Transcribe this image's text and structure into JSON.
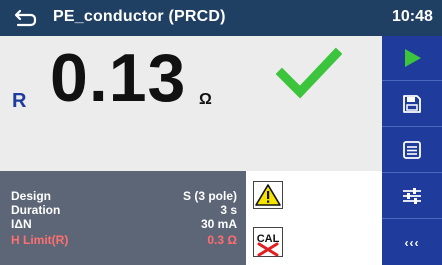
{
  "header": {
    "back_icon": "return-arrow-icon",
    "title": "PE_conductor (PRCD)",
    "time": "10:48"
  },
  "result": {
    "label": "R",
    "value": "0.13",
    "unit": "Ω",
    "status_icon": "check-icon",
    "status_color": "#3cc43c"
  },
  "parameters": [
    {
      "name": "Design",
      "value": "S (3 pole)"
    },
    {
      "name": "Duration",
      "value": "3 s"
    },
    {
      "name": "IΔN",
      "value": "30 mA"
    },
    {
      "name": "H Limit(R)",
      "value": "0.3 Ω"
    }
  ],
  "status_icons": {
    "warning_icon": "warning-triangle-icon",
    "calibration_icon": "cal-crossed-icon",
    "calibration_text": "CAL"
  },
  "toolbar": {
    "items": [
      {
        "name": "start",
        "icon": "play-icon"
      },
      {
        "name": "save",
        "icon": "save-icon"
      },
      {
        "name": "help",
        "icon": "list-icon"
      },
      {
        "name": "settings",
        "icon": "sliders-icon"
      },
      {
        "name": "more",
        "icon": "more-icon",
        "label": "‹‹‹"
      }
    ]
  },
  "colors": {
    "header_bg": "#1f3f63",
    "toolbar_bg": "#1f3b9b",
    "params_bg": "#5c6677",
    "limit_text": "#ff6f6f",
    "play_green": "#3cc43c"
  }
}
